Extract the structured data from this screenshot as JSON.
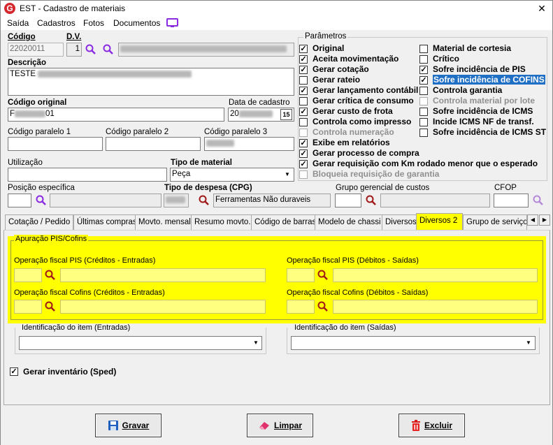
{
  "window": {
    "title": "EST - Cadastro de materiais",
    "close_glyph": "✕"
  },
  "menu": [
    "Saída",
    "Cadastros",
    "Fotos",
    "Documentos"
  ],
  "form": {
    "codigo_label": "Código",
    "codigo_value": "22020011",
    "dv_label": "D.V.",
    "dv_value": "1",
    "descricao_label": "Descrição",
    "descricao_prefix": "TESTE",
    "codigo_original_label": "Código original",
    "codigo_original_prefix": "F",
    "codigo_original_suffix": "01",
    "data_cadastro_label": "Data de cadastro",
    "data_cadastro_prefix": "20",
    "calendar_day": "15",
    "codigo_paralelo_1": "Código paralelo 1",
    "codigo_paralelo_2": "Código paralelo 2",
    "codigo_paralelo_3": "Código paralelo 3",
    "utilizacao_label": "Utilização",
    "tipo_material_label": "Tipo de material",
    "tipo_material_value": "Peça",
    "posicao_label": "Posição específica",
    "tipo_despesa_label": "Tipo de despesa (CPG)",
    "tipo_despesa_value": "Ferramentas Não duraveis",
    "grupo_gerencial_label": "Grupo gerencial de custos",
    "cfop_label": "CFOP"
  },
  "parametros": {
    "title": "Parâmetros",
    "left": [
      {
        "label": "Original",
        "checked": true,
        "disabled": false
      },
      {
        "label": "Aceita movimentação",
        "checked": true,
        "disabled": false
      },
      {
        "label": "Gerar cotação",
        "checked": true,
        "disabled": false
      },
      {
        "label": "Gerar rateio",
        "checked": false,
        "disabled": false
      },
      {
        "label": "Gerar lançamento contábil",
        "checked": true,
        "disabled": false
      },
      {
        "label": "Gerar crítica de consumo",
        "checked": false,
        "disabled": false
      },
      {
        "label": "Gerar custo de frota",
        "checked": true,
        "disabled": false
      },
      {
        "label": "Controla como impresso",
        "checked": false,
        "disabled": false
      },
      {
        "label": "Controla numeração",
        "checked": false,
        "disabled": true
      },
      {
        "label": "Exibe em relatórios",
        "checked": true,
        "disabled": false
      },
      {
        "label": "Gerar processo de compra",
        "checked": true,
        "disabled": false
      },
      {
        "label": "Gerar requisição com Km rodado menor que o esperado",
        "checked": true,
        "disabled": false
      },
      {
        "label": "Bloqueia requisição de garantia",
        "checked": false,
        "disabled": true
      }
    ],
    "right": [
      {
        "label": "Material de cortesia",
        "checked": false,
        "disabled": false
      },
      {
        "label": "Crítico",
        "checked": false,
        "disabled": false
      },
      {
        "label": "Sofre incidência de PIS",
        "checked": true,
        "disabled": false
      },
      {
        "label": "Sofre incidência de COFINS",
        "checked": true,
        "disabled": false,
        "selected": true
      },
      {
        "label": "Controla garantia",
        "checked": false,
        "disabled": false
      },
      {
        "label": "Controla material por lote",
        "checked": false,
        "disabled": true
      },
      {
        "label": "Sofre incidência de ICMS",
        "checked": false,
        "disabled": false
      },
      {
        "label": "Incide ICMS NF de transf.",
        "checked": false,
        "disabled": false
      },
      {
        "label": "Sofre incidência de ICMS ST",
        "checked": false,
        "disabled": false
      }
    ]
  },
  "tabs": [
    "Cotação / Pedido",
    "Últimas compras",
    "Movto. mensal",
    "Resumo movto.",
    "Código de barras",
    "Modelo de chassi",
    "Diversos",
    "Diversos 2",
    "Grupo de serviço"
  ],
  "tab_scroll": {
    "left": "◀",
    "right": "▶"
  },
  "apuracao": {
    "title": "Apuração PIS/Cofins",
    "pis_credito": "Operação fiscal PIS (Créditos - Entradas)",
    "pis_debito": "Operação fiscal PIS (Débitos - Saídas)",
    "cofins_credito": "Operação fiscal Cofins (Créditos - Entradas)",
    "cofins_debito": "Operação fiscal Cofins (Débitos - Saídas)"
  },
  "identificacao": {
    "entradas": "Identificação do item (Entradas)",
    "saidas": "Identificação do item (Saídas)"
  },
  "sped": {
    "label": "Gerar inventário (Sped)",
    "checked": true
  },
  "buttons": {
    "gravar": "Gravar",
    "limpar": "Limpar",
    "excluir": "Excluir"
  },
  "colors": {
    "highlight": "#ffff00",
    "accent_purple": "#8a2be2",
    "search_icon": "#a01818"
  }
}
